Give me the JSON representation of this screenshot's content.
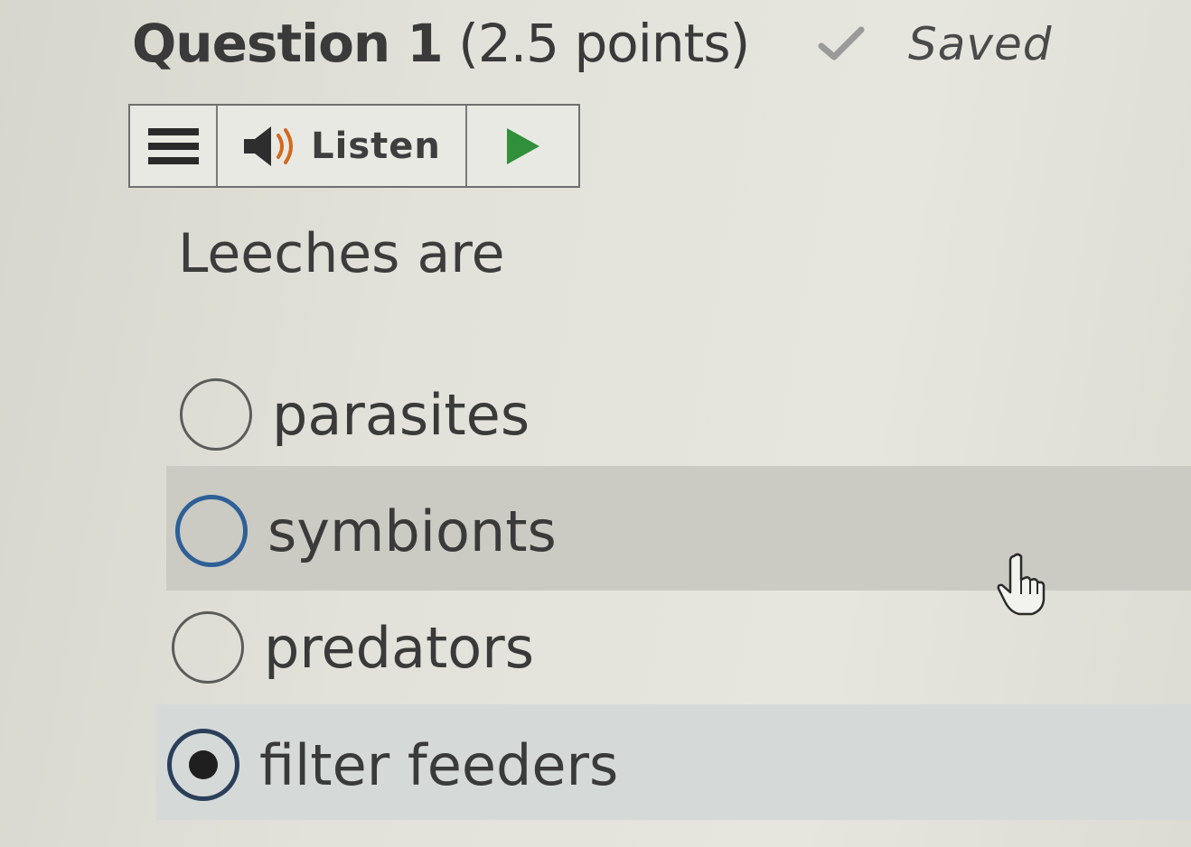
{
  "question": {
    "title": "Question 1",
    "points": "(2.5 points)",
    "status": "Saved",
    "status_icon": "check-icon",
    "prompt": "Leeches are"
  },
  "toolbar": {
    "menu_icon": "menu-icon",
    "listen_label": "Listen",
    "speaker_icon": "speaker-icon",
    "play_icon": "play-icon"
  },
  "options": [
    {
      "label": "parasites",
      "checked": false
    },
    {
      "label": "symbionts",
      "checked": false
    },
    {
      "label": "predators",
      "checked": false
    },
    {
      "label": "filter feeders",
      "checked": true
    }
  ],
  "colors": {
    "focus_ring": "#2e5f96",
    "play_green": "#2f8f3a",
    "speaker_orange": "#d2691e",
    "selected_row": "#d5dad8",
    "hover_row": "#cbcbc3"
  }
}
